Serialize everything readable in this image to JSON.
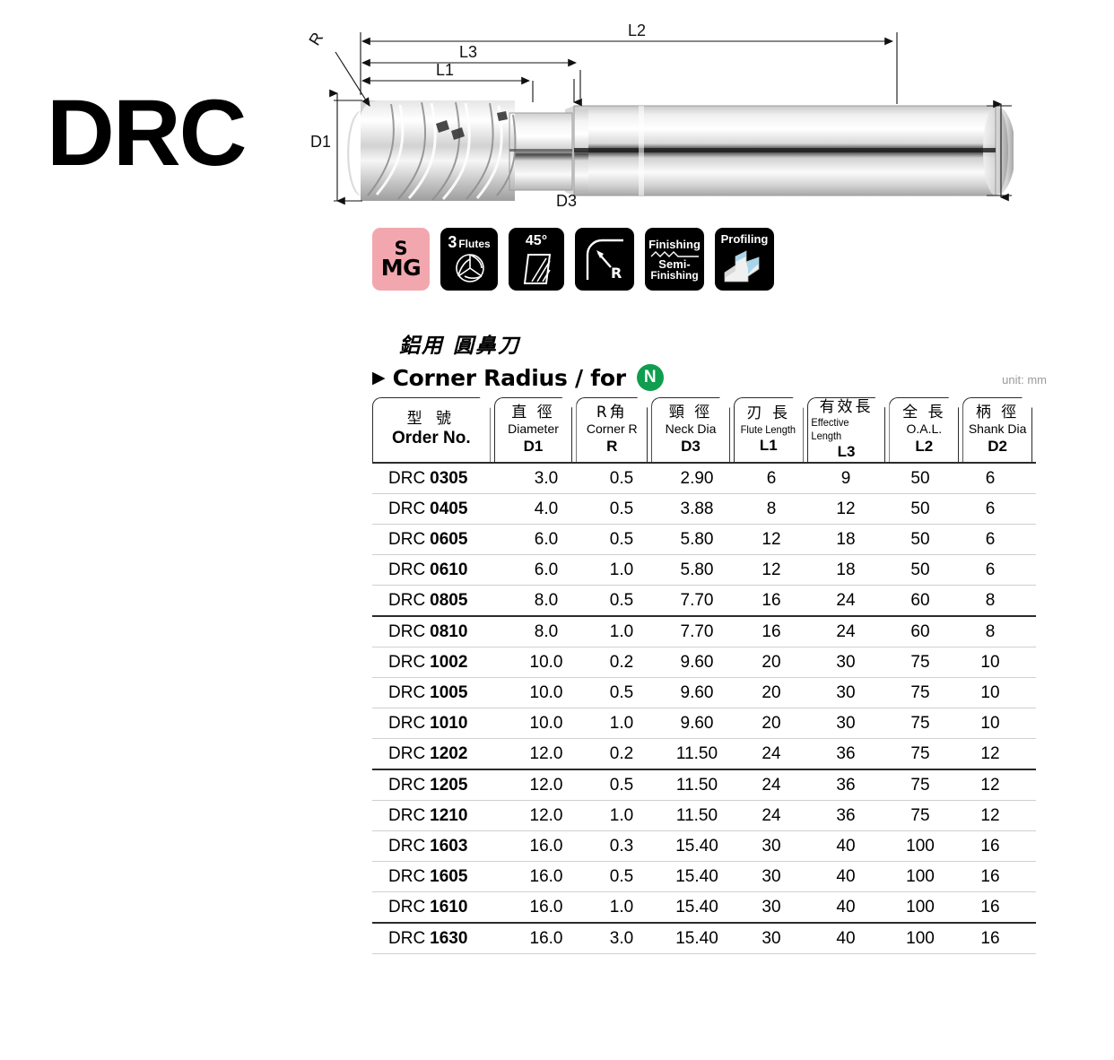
{
  "product_code": "DRC",
  "drawing": {
    "labels": {
      "R": "R",
      "L1": "L1",
      "L2": "L2",
      "L3": "L3",
      "D1": "D1",
      "D2": "D2",
      "D3": "D3"
    }
  },
  "feature_icons": [
    {
      "name": "smg-material-badge",
      "line1": "S",
      "line2": "MG",
      "bg": "#f2a7ae"
    },
    {
      "name": "flutes-icon",
      "count": "3",
      "word": "Flutes"
    },
    {
      "name": "helix-angle-icon",
      "label": "45°"
    },
    {
      "name": "corner-radius-icon",
      "label": "R"
    },
    {
      "name": "finishing-icon",
      "line1": "Finishing",
      "line2": "Semi-",
      "line3": "Finishing"
    },
    {
      "name": "profiling-icon",
      "label": "Profiling"
    }
  ],
  "section": {
    "cn_subtitle": "鋁用  圓鼻刀",
    "arrow": "▶",
    "en_title": "Corner Radius / for",
    "material_badge": "N",
    "material_badge_color": "#0f9d4f",
    "unit_note": "unit: mm"
  },
  "table": {
    "columns": [
      {
        "cn": "型  號",
        "en": "",
        "sym": "Order No."
      },
      {
        "cn": "直  徑",
        "en": "Diameter",
        "sym": "D1"
      },
      {
        "cn": "R角",
        "en": "Corner R",
        "sym": "R"
      },
      {
        "cn": "頸  徑",
        "en": "Neck Dia",
        "sym": "D3"
      },
      {
        "cn": "刃  長",
        "en": "Flute Length",
        "sym": "L1"
      },
      {
        "cn": "有效長",
        "en": "Effective Length",
        "sym": "L3"
      },
      {
        "cn": "全  長",
        "en": "O.A.L.",
        "sym": "L2"
      },
      {
        "cn": "柄  徑",
        "en": "Shank Dia",
        "sym": "D2"
      }
    ],
    "rows": [
      {
        "prefix": "DRC",
        "code": "0305",
        "D1": "3.0",
        "R": "0.5",
        "D3": "2.90",
        "L1": "6",
        "L3": "9",
        "L2": "50",
        "D2": "6",
        "group_end": false
      },
      {
        "prefix": "DRC",
        "code": "0405",
        "D1": "4.0",
        "R": "0.5",
        "D3": "3.88",
        "L1": "8",
        "L3": "12",
        "L2": "50",
        "D2": "6",
        "group_end": false
      },
      {
        "prefix": "DRC",
        "code": "0605",
        "D1": "6.0",
        "R": "0.5",
        "D3": "5.80",
        "L1": "12",
        "L3": "18",
        "L2": "50",
        "D2": "6",
        "group_end": false
      },
      {
        "prefix": "DRC",
        "code": "0610",
        "D1": "6.0",
        "R": "1.0",
        "D3": "5.80",
        "L1": "12",
        "L3": "18",
        "L2": "50",
        "D2": "6",
        "group_end": false
      },
      {
        "prefix": "DRC",
        "code": "0805",
        "D1": "8.0",
        "R": "0.5",
        "D3": "7.70",
        "L1": "16",
        "L3": "24",
        "L2": "60",
        "D2": "8",
        "group_end": true
      },
      {
        "prefix": "DRC",
        "code": "0810",
        "D1": "8.0",
        "R": "1.0",
        "D3": "7.70",
        "L1": "16",
        "L3": "24",
        "L2": "60",
        "D2": "8",
        "group_end": false
      },
      {
        "prefix": "DRC",
        "code": "1002",
        "D1": "10.0",
        "R": "0.2",
        "D3": "9.60",
        "L1": "20",
        "L3": "30",
        "L2": "75",
        "D2": "10",
        "group_end": false
      },
      {
        "prefix": "DRC",
        "code": "1005",
        "D1": "10.0",
        "R": "0.5",
        "D3": "9.60",
        "L1": "20",
        "L3": "30",
        "L2": "75",
        "D2": "10",
        "group_end": false
      },
      {
        "prefix": "DRC",
        "code": "1010",
        "D1": "10.0",
        "R": "1.0",
        "D3": "9.60",
        "L1": "20",
        "L3": "30",
        "L2": "75",
        "D2": "10",
        "group_end": false
      },
      {
        "prefix": "DRC",
        "code": "1202",
        "D1": "12.0",
        "R": "0.2",
        "D3": "11.50",
        "L1": "24",
        "L3": "36",
        "L2": "75",
        "D2": "12",
        "group_end": true
      },
      {
        "prefix": "DRC",
        "code": "1205",
        "D1": "12.0",
        "R": "0.5",
        "D3": "11.50",
        "L1": "24",
        "L3": "36",
        "L2": "75",
        "D2": "12",
        "group_end": false
      },
      {
        "prefix": "DRC",
        "code": "1210",
        "D1": "12.0",
        "R": "1.0",
        "D3": "11.50",
        "L1": "24",
        "L3": "36",
        "L2": "75",
        "D2": "12",
        "group_end": false
      },
      {
        "prefix": "DRC",
        "code": "1603",
        "D1": "16.0",
        "R": "0.3",
        "D3": "15.40",
        "L1": "30",
        "L3": "40",
        "L2": "100",
        "D2": "16",
        "group_end": false
      },
      {
        "prefix": "DRC",
        "code": "1605",
        "D1": "16.0",
        "R": "0.5",
        "D3": "15.40",
        "L1": "30",
        "L3": "40",
        "L2": "100",
        "D2": "16",
        "group_end": false
      },
      {
        "prefix": "DRC",
        "code": "1610",
        "D1": "16.0",
        "R": "1.0",
        "D3": "15.40",
        "L1": "30",
        "L3": "40",
        "L2": "100",
        "D2": "16",
        "group_end": true
      },
      {
        "prefix": "DRC",
        "code": "1630",
        "D1": "16.0",
        "R": "3.0",
        "D3": "15.40",
        "L1": "30",
        "L3": "40",
        "L2": "100",
        "D2": "16",
        "group_end": false
      }
    ]
  }
}
